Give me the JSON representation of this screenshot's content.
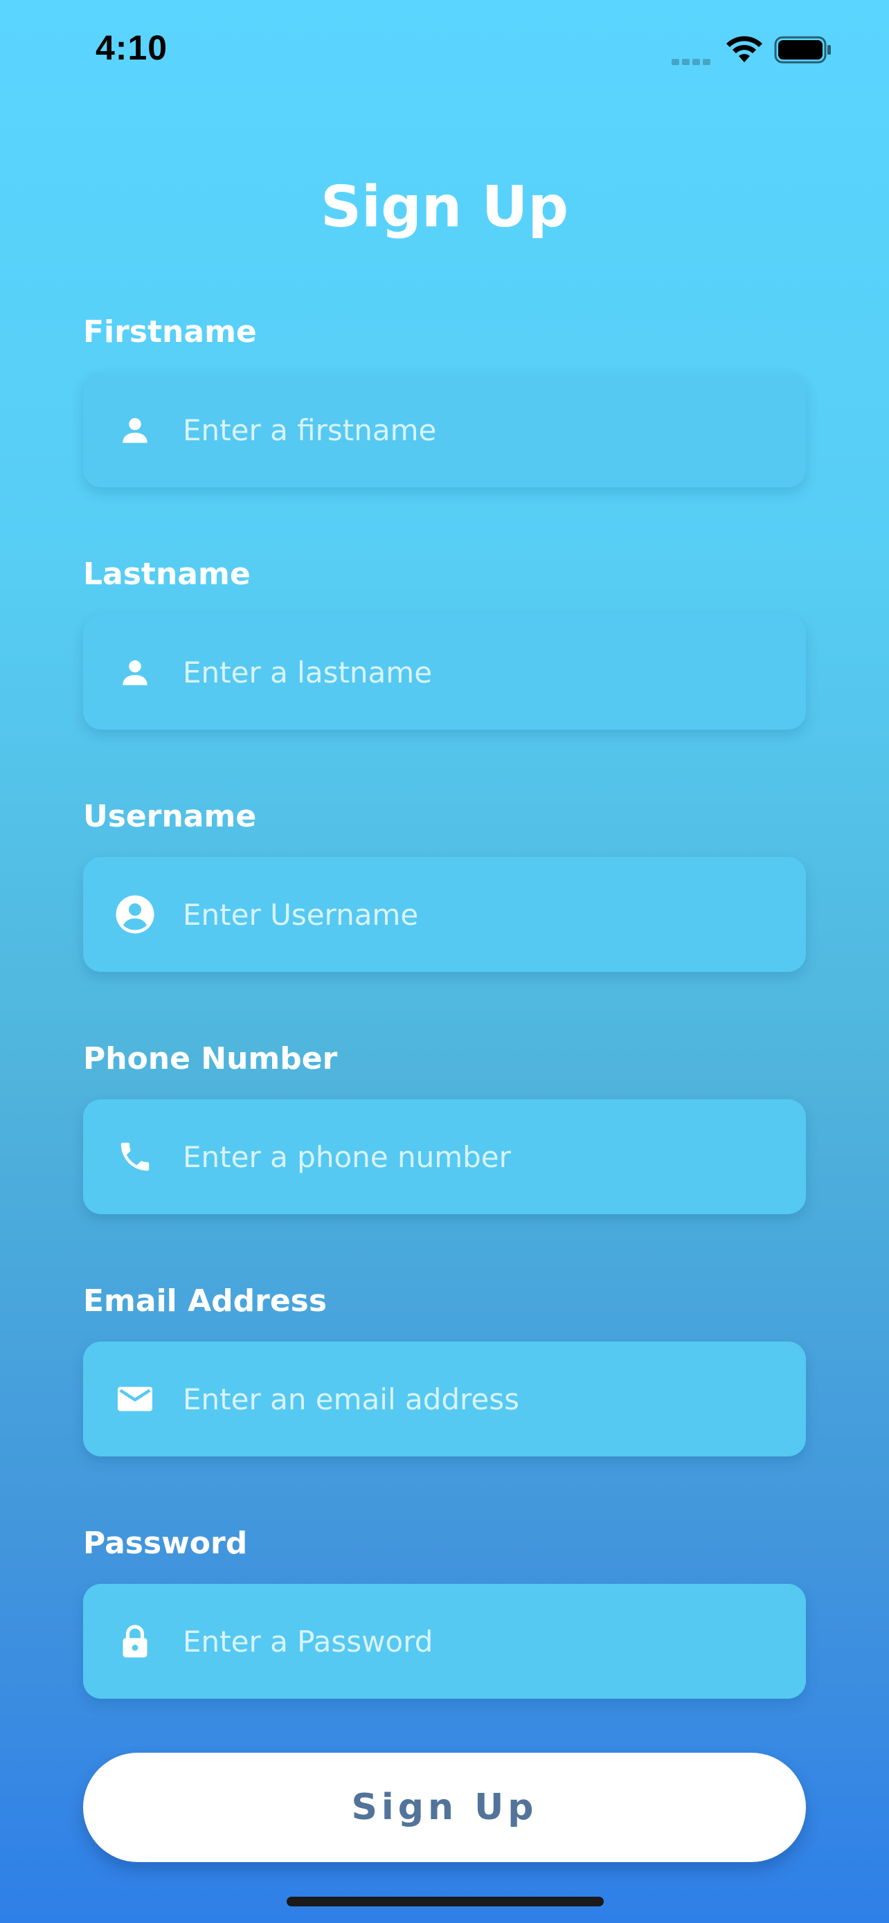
{
  "status_bar": {
    "time": "4:10"
  },
  "title": "Sign Up",
  "fields": [
    {
      "label": "Firstname",
      "placeholder": "Enter a firstname",
      "icon": "person-icon"
    },
    {
      "label": "Lastname",
      "placeholder": "Enter a lastname",
      "icon": "person-icon"
    },
    {
      "label": "Username",
      "placeholder": "Enter Username",
      "icon": "account-circle-icon"
    },
    {
      "label": "Phone Number",
      "placeholder": "Enter a phone number",
      "icon": "phone-icon"
    },
    {
      "label": "Email Address",
      "placeholder": "Enter an email address",
      "icon": "mail-icon"
    },
    {
      "label": "Password",
      "placeholder": "Enter a Password",
      "icon": "lock-icon"
    }
  ],
  "button": {
    "label": "Sign Up"
  },
  "colors": {
    "gradient_top": "#5ad5ff",
    "gradient_bottom": "#2f7fe8",
    "field_background": "#55c9f1",
    "button_text": "#52739a"
  }
}
